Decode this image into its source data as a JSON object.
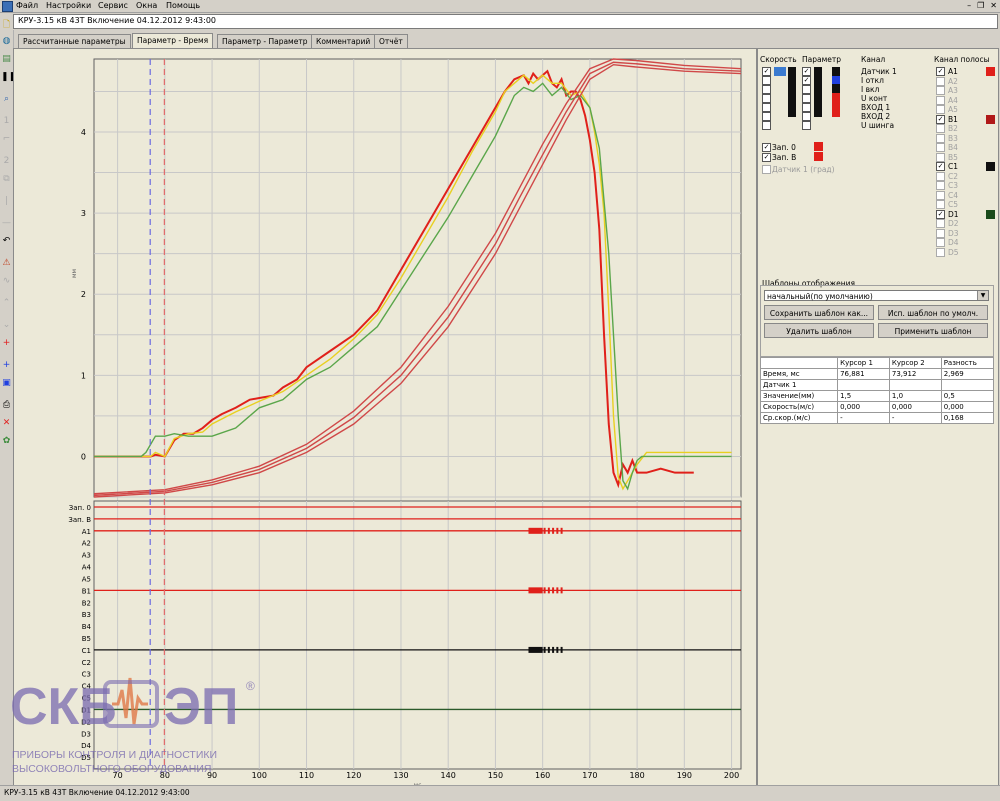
{
  "menu": {
    "items": [
      "Файл",
      "Настройки",
      "Сервис",
      "Окна",
      "Помощь"
    ]
  },
  "window": {
    "title": "КРУ-3.15 кВ 43Т Включение 04.12.2012 9:43:00"
  },
  "tabs": [
    {
      "label": "Рассчитанные параметры",
      "active": false
    },
    {
      "label": "Параметр - Время",
      "active": true
    },
    {
      "label": "Параметр - Параметр",
      "active": false
    },
    {
      "label": "Комментарий",
      "active": false
    },
    {
      "label": "Отчёт",
      "active": false
    }
  ],
  "right_panel": {
    "col_speed": "Скорость",
    "col_param": "Параметр",
    "col_channel": "Канал",
    "col_channel_strip": "Канал полосы",
    "channels": [
      "Датчик 1",
      "I откл",
      "I вкл",
      "U конт",
      "ВХОД 1",
      "ВХОД 2",
      "U шинга"
    ],
    "zap": [
      "Зап. 0",
      "Зап. В"
    ],
    "disabled_channel": "Датчик 1 (град)",
    "strip_channels": [
      "A1",
      "A2",
      "A3",
      "A4",
      "A5",
      "B1",
      "B2",
      "B3",
      "B4",
      "B5",
      "C1",
      "C2",
      "C3",
      "C4",
      "C5",
      "D1",
      "D2",
      "D3",
      "D4",
      "D5"
    ],
    "templates_title": "Шаблоны отображения",
    "template_selected": "начальный(по умолчанию)",
    "btn_save": "Сохранить шаблон как...",
    "btn_use_default": "Исп. шаблон по умолч.",
    "btn_delete": "Удалить шаблон",
    "btn_apply": "Применить шаблон",
    "table_headers": [
      "",
      "Курсор 1",
      "Курсор 2",
      "Разность"
    ],
    "table_rows": [
      [
        "Время, мс",
        "76,881",
        "73,912",
        "2,969"
      ],
      [
        "Датчик 1",
        "",
        "",
        ""
      ],
      [
        "Значение(мм)",
        "1,5",
        "1,0",
        "0,5"
      ],
      [
        "Скорость(м/с)",
        "0,000",
        "0,000",
        "0,000"
      ],
      [
        "Ср.скор.(м/с)",
        "-",
        "-",
        "0,168"
      ]
    ]
  },
  "status": {
    "text": "КРУ-3.15 кВ 43Т Включение 04.12.2012 9:43:00"
  },
  "logo": {
    "brand_left": "СКБ",
    "brand_right": "ЭП",
    "tagline1": "ПРИБОРЫ КОНТРОЛЯ И ДИАГНОСТИКИ",
    "tagline2": "ВЫСОКОВОЛЬТНОГО ОБОРУДОВАНИЯ",
    "registered": "®"
  },
  "colors": {
    "red": "#e0201a",
    "yellow": "#e8d020",
    "green": "#5aa64a",
    "pink": "#d04848",
    "black_strip": "#101010",
    "green_strip": "#2a5a2a",
    "cursor1": "#6a6ae0",
    "cursor2": "#e06a6a"
  },
  "chart_data": {
    "type": "line",
    "ylabel": "мм",
    "xlabel": "мс",
    "xlim": [
      65,
      202
    ],
    "ylim": [
      -0.5,
      4.9
    ],
    "x_ticks": [
      70,
      80,
      90,
      100,
      110,
      120,
      130,
      140,
      150,
      160,
      170,
      180,
      190,
      200
    ],
    "y_ticks": [
      0,
      1,
      2,
      3,
      4
    ],
    "cursor1_x": 76.9,
    "cursor2_x": 79.9,
    "series": [
      {
        "color": "red",
        "x": [
          65,
          75,
          77,
          78,
          80,
          81,
          82,
          84,
          86,
          88,
          90,
          92,
          95,
          98,
          100,
          103,
          105,
          108,
          110,
          115,
          120,
          125,
          130,
          135,
          140,
          145,
          150,
          152,
          154,
          156,
          157,
          158,
          159,
          160,
          161,
          162,
          163,
          164,
          165,
          166,
          167,
          168,
          169,
          170,
          171,
          172,
          173,
          174,
          175,
          176,
          177,
          178,
          179,
          180,
          181,
          182,
          185,
          188,
          190,
          192
        ],
        "y": [
          0,
          0,
          0,
          0.02,
          0,
          0.1,
          0.2,
          0.28,
          0.28,
          0.35,
          0.45,
          0.52,
          0.6,
          0.7,
          0.72,
          0.75,
          0.85,
          0.95,
          1.1,
          1.3,
          1.5,
          1.8,
          2.3,
          2.8,
          3.3,
          3.8,
          4.3,
          4.5,
          4.65,
          4.7,
          4.6,
          4.72,
          4.65,
          4.7,
          4.75,
          4.6,
          4.55,
          4.65,
          4.45,
          4.5,
          4.5,
          4.4,
          4.2,
          3.9,
          3.5,
          2.8,
          1.5,
          0.4,
          -0.2,
          -0.35,
          -0.1,
          -0.2,
          -0.05,
          -0.2,
          -0.2,
          -0.2,
          -0.15,
          -0.2,
          -0.2,
          -0.2
        ]
      },
      {
        "color": "yellow",
        "x": [
          65,
          75,
          77,
          78,
          80,
          82,
          85,
          88,
          90,
          95,
          100,
          105,
          110,
          115,
          120,
          125,
          130,
          135,
          140,
          145,
          150,
          152,
          154,
          156,
          158,
          160,
          162,
          164,
          166,
          168,
          170,
          171,
          172,
          173,
          174,
          175,
          176,
          177,
          178,
          180,
          182,
          185,
          190,
          200
        ],
        "y": [
          0,
          0,
          0,
          0.05,
          0,
          0.22,
          0.28,
          0.3,
          0.4,
          0.55,
          0.68,
          0.8,
          1.0,
          1.2,
          1.45,
          1.75,
          2.2,
          2.7,
          3.2,
          3.75,
          4.25,
          4.5,
          4.6,
          4.7,
          4.6,
          4.7,
          4.6,
          4.6,
          4.45,
          4.5,
          4.3,
          4.0,
          3.6,
          3.0,
          1.8,
          0.5,
          -0.25,
          -0.4,
          -0.3,
          -0.1,
          0.05,
          0.05,
          0.05,
          0.05
        ]
      },
      {
        "color": "green",
        "x": [
          65,
          75,
          76,
          78,
          80,
          82,
          85,
          88,
          90,
          95,
          100,
          105,
          110,
          115,
          120,
          125,
          130,
          135,
          140,
          145,
          150,
          152,
          154,
          156,
          158,
          160,
          162,
          164,
          166,
          168,
          170,
          172,
          174,
          176,
          177,
          178,
          179,
          180,
          181,
          182,
          185,
          190,
          200
        ],
        "y": [
          0,
          0,
          0.05,
          0.25,
          0.25,
          0.28,
          0.25,
          0.25,
          0.25,
          0.35,
          0.6,
          0.7,
          0.95,
          1.1,
          1.35,
          1.6,
          2.05,
          2.5,
          2.95,
          3.45,
          3.95,
          4.2,
          4.45,
          4.55,
          4.5,
          4.6,
          4.45,
          4.55,
          4.4,
          4.45,
          4.3,
          3.8,
          2.5,
          0.5,
          -0.3,
          -0.4,
          -0.2,
          -0.05,
          0,
          0,
          0,
          0,
          0
        ]
      },
      {
        "color": "pink",
        "x": [
          65,
          80,
          90,
          100,
          110,
          120,
          130,
          140,
          150,
          155,
          160,
          165,
          170,
          175,
          180,
          190,
          202
        ],
        "y": [
          -0.5,
          -0.45,
          -0.35,
          -0.2,
          0.05,
          0.4,
          0.9,
          1.6,
          2.5,
          3.05,
          3.6,
          4.15,
          4.65,
          4.83,
          4.8,
          4.75,
          4.72
        ]
      },
      {
        "color": "pink",
        "x": [
          65,
          80,
          90,
          100,
          110,
          120,
          130,
          140,
          150,
          155,
          160,
          165,
          170,
          175,
          180,
          190,
          202
        ],
        "y": [
          -0.48,
          -0.43,
          -0.32,
          -0.16,
          0.1,
          0.48,
          1.0,
          1.72,
          2.62,
          3.18,
          3.72,
          4.25,
          4.72,
          4.86,
          4.84,
          4.78,
          4.75
        ]
      },
      {
        "color": "pink",
        "x": [
          65,
          80,
          90,
          100,
          110,
          120,
          130,
          140,
          150,
          155,
          160,
          165,
          170,
          175,
          180,
          190,
          202
        ],
        "y": [
          -0.46,
          -0.41,
          -0.29,
          -0.12,
          0.15,
          0.56,
          1.1,
          1.85,
          2.75,
          3.3,
          3.85,
          4.35,
          4.78,
          4.9,
          4.88,
          4.82,
          4.78
        ]
      }
    ],
    "strip_labels": [
      "Зап. 0",
      "Зап. В",
      "A1",
      "A2",
      "A3",
      "A4",
      "A5",
      "B1",
      "B2",
      "B3",
      "B4",
      "B5",
      "C1",
      "C2",
      "C3",
      "C4",
      "C5",
      "D1",
      "D2",
      "D3",
      "D4",
      "D5"
    ],
    "strips": [
      {
        "label": "Зап. 0",
        "color": "red",
        "active_from": null
      },
      {
        "label": "Зап. В",
        "color": "red",
        "active_from": null
      },
      {
        "label": "A1",
        "color": "red",
        "active_from": 157
      },
      {
        "label": "B1",
        "color": "red",
        "active_from": 157
      },
      {
        "label": "C1",
        "color": "black_strip",
        "active_from": 157
      },
      {
        "label": "D1",
        "color": "green_strip",
        "active_from": null
      }
    ]
  }
}
